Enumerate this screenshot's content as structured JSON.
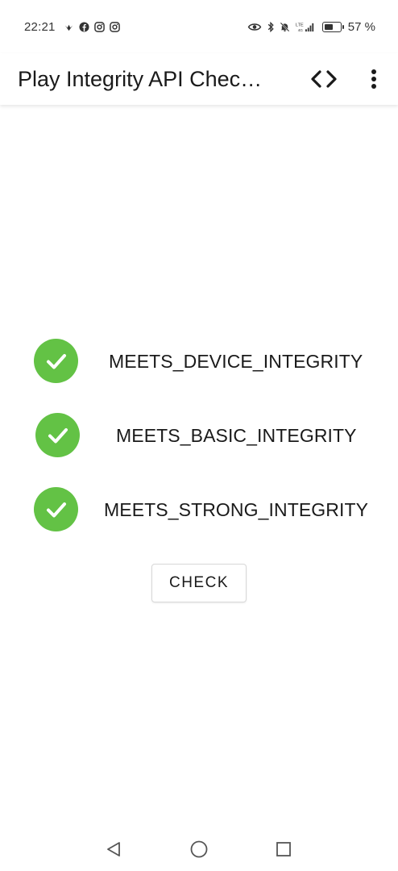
{
  "status_bar": {
    "time": "22:21",
    "battery_percent_text": "57 %",
    "battery_level": 0.57,
    "icons_left": [
      "heart-rate-icon",
      "facebook-icon",
      "instagram-icon",
      "instagram-icon"
    ],
    "icons_right": [
      "eye-icon",
      "bluetooth-icon",
      "bell-off-icon",
      "lte-signal-icon",
      "battery-icon"
    ]
  },
  "app_bar": {
    "title": "Play Integrity API Chec…",
    "actions": [
      "code-icon",
      "more-vert-icon"
    ]
  },
  "checks": [
    {
      "label": "MEETS_DEVICE_INTEGRITY",
      "passed": true
    },
    {
      "label": "MEETS_BASIC_INTEGRITY",
      "passed": true
    },
    {
      "label": "MEETS_STRONG_INTEGRITY",
      "passed": true
    }
  ],
  "check_button": {
    "label": "CHECK"
  },
  "colors": {
    "success": "#63c245",
    "text": "#1a1a1a",
    "background": "#ffffff"
  },
  "nav_bar": {
    "buttons": [
      "back-icon",
      "home-icon",
      "recents-icon"
    ]
  }
}
